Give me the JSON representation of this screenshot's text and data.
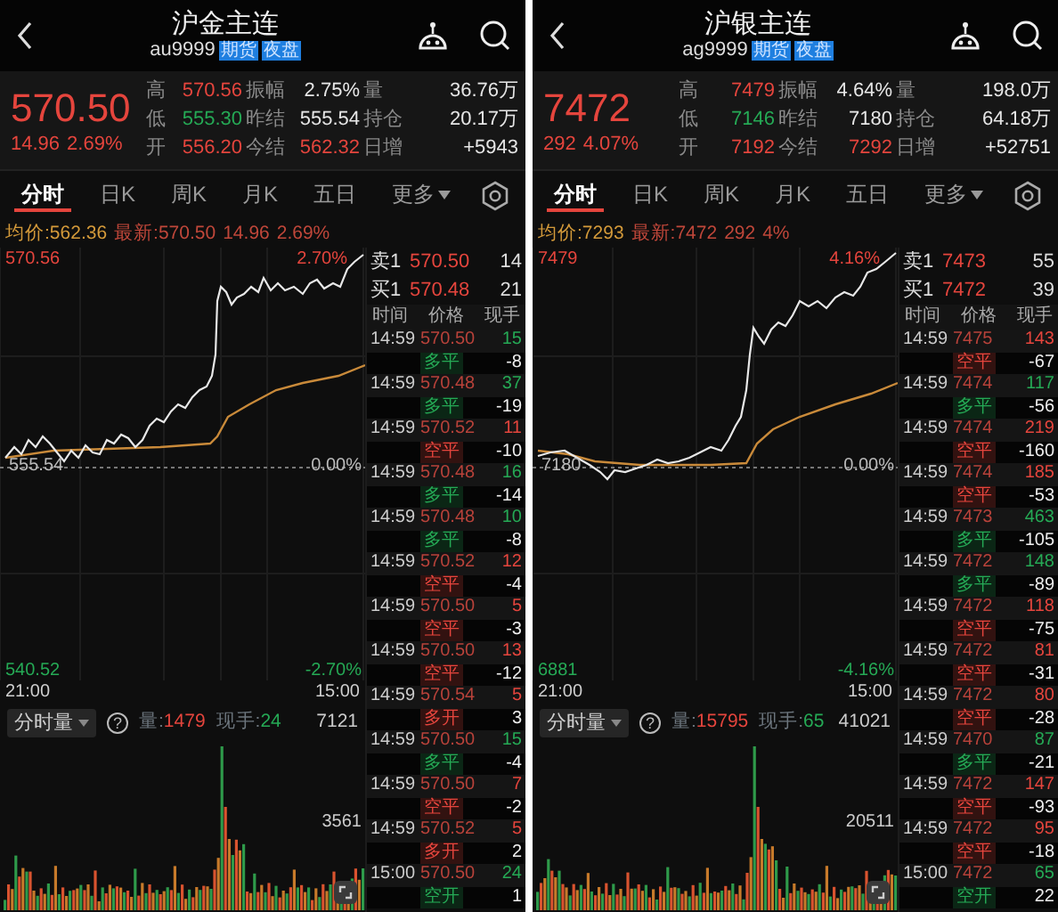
{
  "panels": [
    {
      "title": "沪金主连",
      "code": "au9999",
      "badges": [
        "期货",
        "夜盘"
      ],
      "quote": {
        "price": "570.50",
        "change": "14.96",
        "change_pct": "2.69%",
        "color": "#e5453d"
      },
      "stats": [
        {
          "label": "高",
          "value": "570.56",
          "color": "#e5453d"
        },
        {
          "label": "振幅",
          "value": "2.75%",
          "color": "#e6e6e6"
        },
        {
          "label": "量",
          "value": "36.76万",
          "color": "#e6e6e6"
        },
        {
          "label": "低",
          "value": "555.30",
          "color": "#25a955"
        },
        {
          "label": "昨结",
          "value": "555.54",
          "color": "#e6e6e6"
        },
        {
          "label": "持仓",
          "value": "20.17万",
          "color": "#e6e6e6"
        },
        {
          "label": "开",
          "value": "556.20",
          "color": "#e5453d"
        },
        {
          "label": "今结",
          "value": "562.32",
          "color": "#e5453d"
        },
        {
          "label": "日增",
          "value": "+5943",
          "color": "#e6e6e6"
        }
      ],
      "tabs": [
        {
          "label": "分时",
          "selected": true,
          "kind": "tab"
        },
        {
          "label": "日K",
          "selected": false,
          "kind": "tab"
        },
        {
          "label": "周K",
          "selected": false,
          "kind": "tab"
        },
        {
          "label": "月K",
          "selected": false,
          "kind": "tab"
        },
        {
          "label": "五日",
          "selected": false,
          "kind": "tab"
        },
        {
          "label": "更多",
          "selected": false,
          "kind": "menu"
        }
      ],
      "info": {
        "avg_label": "均价:",
        "avg": "562.36",
        "latest_label": "最新:",
        "latest": "570.50",
        "change": "14.96",
        "change_pct": "2.69%"
      },
      "axis": {
        "high": "570.56",
        "high_pct": "2.70%",
        "base": "555.54",
        "base_pct": "0.00%",
        "low": "540.52",
        "low_pct": "-2.70%",
        "start_time": "21:00",
        "end_time": "15:00"
      },
      "volume": {
        "selector": "分时量",
        "help": "?",
        "volume_label": "量:",
        "volume": "1479",
        "last_label": "现手:",
        "last": "24",
        "max": "7121",
        "mid": "3561"
      },
      "order_book": [
        {
          "label": "卖1",
          "price": "570.50",
          "size": "14"
        },
        {
          "label": "买1",
          "price": "570.48",
          "size": "21"
        }
      ],
      "ticks_header": [
        "时间",
        "价格",
        "现手"
      ],
      "ticks": [
        {
          "time": "14:59",
          "price": "570.50",
          "volume": "15",
          "color": "#25a955",
          "type": "多平",
          "delta": "-8"
        },
        {
          "time": "14:59",
          "price": "570.48",
          "volume": "37",
          "color": "#25a955",
          "type": "多平",
          "delta": "-19"
        },
        {
          "time": "14:59",
          "price": "570.52",
          "volume": "11",
          "color": "#e5453d",
          "type": "空平",
          "delta": "-10"
        },
        {
          "time": "14:59",
          "price": "570.48",
          "volume": "16",
          "color": "#25a955",
          "type": "多平",
          "delta": "-14"
        },
        {
          "time": "14:59",
          "price": "570.48",
          "volume": "10",
          "color": "#25a955",
          "type": "多平",
          "delta": "-8"
        },
        {
          "time": "14:59",
          "price": "570.52",
          "volume": "12",
          "color": "#e5453d",
          "type": "空平",
          "delta": "-4"
        },
        {
          "time": "14:59",
          "price": "570.50",
          "volume": "5",
          "color": "#e5453d",
          "type": "空平",
          "delta": "-3"
        },
        {
          "time": "14:59",
          "price": "570.50",
          "volume": "13",
          "color": "#e5453d",
          "type": "空平",
          "delta": "-12"
        },
        {
          "time": "14:59",
          "price": "570.54",
          "volume": "5",
          "color": "#e5453d",
          "type": "多开",
          "delta": "3"
        },
        {
          "time": "14:59",
          "price": "570.50",
          "volume": "15",
          "color": "#25a955",
          "type": "多平",
          "delta": "-4"
        },
        {
          "time": "14:59",
          "price": "570.50",
          "volume": "7",
          "color": "#e5453d",
          "type": "空平",
          "delta": "-2"
        },
        {
          "time": "14:59",
          "price": "570.52",
          "volume": "5",
          "color": "#e5453d",
          "type": "多开",
          "delta": "2"
        },
        {
          "time": "15:00",
          "price": "570.50",
          "volume": "24",
          "color": "#25a955",
          "type": "空开",
          "delta": "1"
        }
      ]
    },
    {
      "title": "沪银主连",
      "code": "ag9999",
      "badges": [
        "期货",
        "夜盘"
      ],
      "quote": {
        "price": "7472",
        "change": "292",
        "change_pct": "4.07%",
        "color": "#e5453d"
      },
      "stats": [
        {
          "label": "高",
          "value": "7479",
          "color": "#e5453d"
        },
        {
          "label": "振幅",
          "value": "4.64%",
          "color": "#e6e6e6"
        },
        {
          "label": "量",
          "value": "198.0万",
          "color": "#e6e6e6"
        },
        {
          "label": "低",
          "value": "7146",
          "color": "#25a955"
        },
        {
          "label": "昨结",
          "value": "7180",
          "color": "#e6e6e6"
        },
        {
          "label": "持仓",
          "value": "64.18万",
          "color": "#e6e6e6"
        },
        {
          "label": "开",
          "value": "7192",
          "color": "#e5453d"
        },
        {
          "label": "今结",
          "value": "7292",
          "color": "#e5453d"
        },
        {
          "label": "日增",
          "value": "+52751",
          "color": "#e6e6e6"
        }
      ],
      "tabs": [
        {
          "label": "分时",
          "selected": true,
          "kind": "tab"
        },
        {
          "label": "日K",
          "selected": false,
          "kind": "tab"
        },
        {
          "label": "周K",
          "selected": false,
          "kind": "tab"
        },
        {
          "label": "月K",
          "selected": false,
          "kind": "tab"
        },
        {
          "label": "五日",
          "selected": false,
          "kind": "tab"
        },
        {
          "label": "更多",
          "selected": false,
          "kind": "menu"
        }
      ],
      "info": {
        "avg_label": "均价:",
        "avg": "7293",
        "latest_label": "最新:",
        "latest": "7472",
        "change": "292",
        "change_pct": "4%"
      },
      "axis": {
        "high": "7479",
        "high_pct": "4.16%",
        "base": "7180",
        "base_pct": "0.00%",
        "low": "6881",
        "low_pct": "-4.16%",
        "start_time": "21:00",
        "end_time": "15:00"
      },
      "volume": {
        "selector": "分时量",
        "help": "?",
        "volume_label": "量:",
        "volume": "15795",
        "last_label": "现手:",
        "last": "65",
        "max": "41021",
        "mid": "20511"
      },
      "order_book": [
        {
          "label": "卖1",
          "price": "7473",
          "size": "55"
        },
        {
          "label": "买1",
          "price": "7472",
          "size": "39"
        }
      ],
      "ticks_header": [
        "时间",
        "价格",
        "现手"
      ],
      "ticks": [
        {
          "time": "14:59",
          "price": "7475",
          "volume": "143",
          "color": "#e5453d",
          "type": "空平",
          "delta": "-67"
        },
        {
          "time": "14:59",
          "price": "7474",
          "volume": "117",
          "color": "#25a955",
          "type": "多平",
          "delta": "-56"
        },
        {
          "time": "14:59",
          "price": "7474",
          "volume": "219",
          "color": "#e5453d",
          "type": "空平",
          "delta": "-160"
        },
        {
          "time": "14:59",
          "price": "7474",
          "volume": "185",
          "color": "#e5453d",
          "type": "空平",
          "delta": "-53"
        },
        {
          "time": "14:59",
          "price": "7473",
          "volume": "463",
          "color": "#25a955",
          "type": "多平",
          "delta": "-105"
        },
        {
          "time": "14:59",
          "price": "7472",
          "volume": "148",
          "color": "#25a955",
          "type": "多平",
          "delta": "-89"
        },
        {
          "time": "14:59",
          "price": "7472",
          "volume": "118",
          "color": "#e5453d",
          "type": "空平",
          "delta": "-75"
        },
        {
          "time": "14:59",
          "price": "7472",
          "volume": "81",
          "color": "#e5453d",
          "type": "空平",
          "delta": "-31"
        },
        {
          "time": "14:59",
          "price": "7472",
          "volume": "80",
          "color": "#e5453d",
          "type": "空平",
          "delta": "-28"
        },
        {
          "time": "14:59",
          "price": "7470",
          "volume": "87",
          "color": "#25a955",
          "type": "多平",
          "delta": "-21"
        },
        {
          "time": "14:59",
          "price": "7472",
          "volume": "147",
          "color": "#e5453d",
          "type": "空平",
          "delta": "-93"
        },
        {
          "time": "14:59",
          "price": "7472",
          "volume": "95",
          "color": "#e5453d",
          "type": "空平",
          "delta": "-18"
        },
        {
          "time": "15:00",
          "price": "7472",
          "volume": "65",
          "color": "#25a955",
          "type": "空开",
          "delta": "22"
        }
      ]
    }
  ]
}
